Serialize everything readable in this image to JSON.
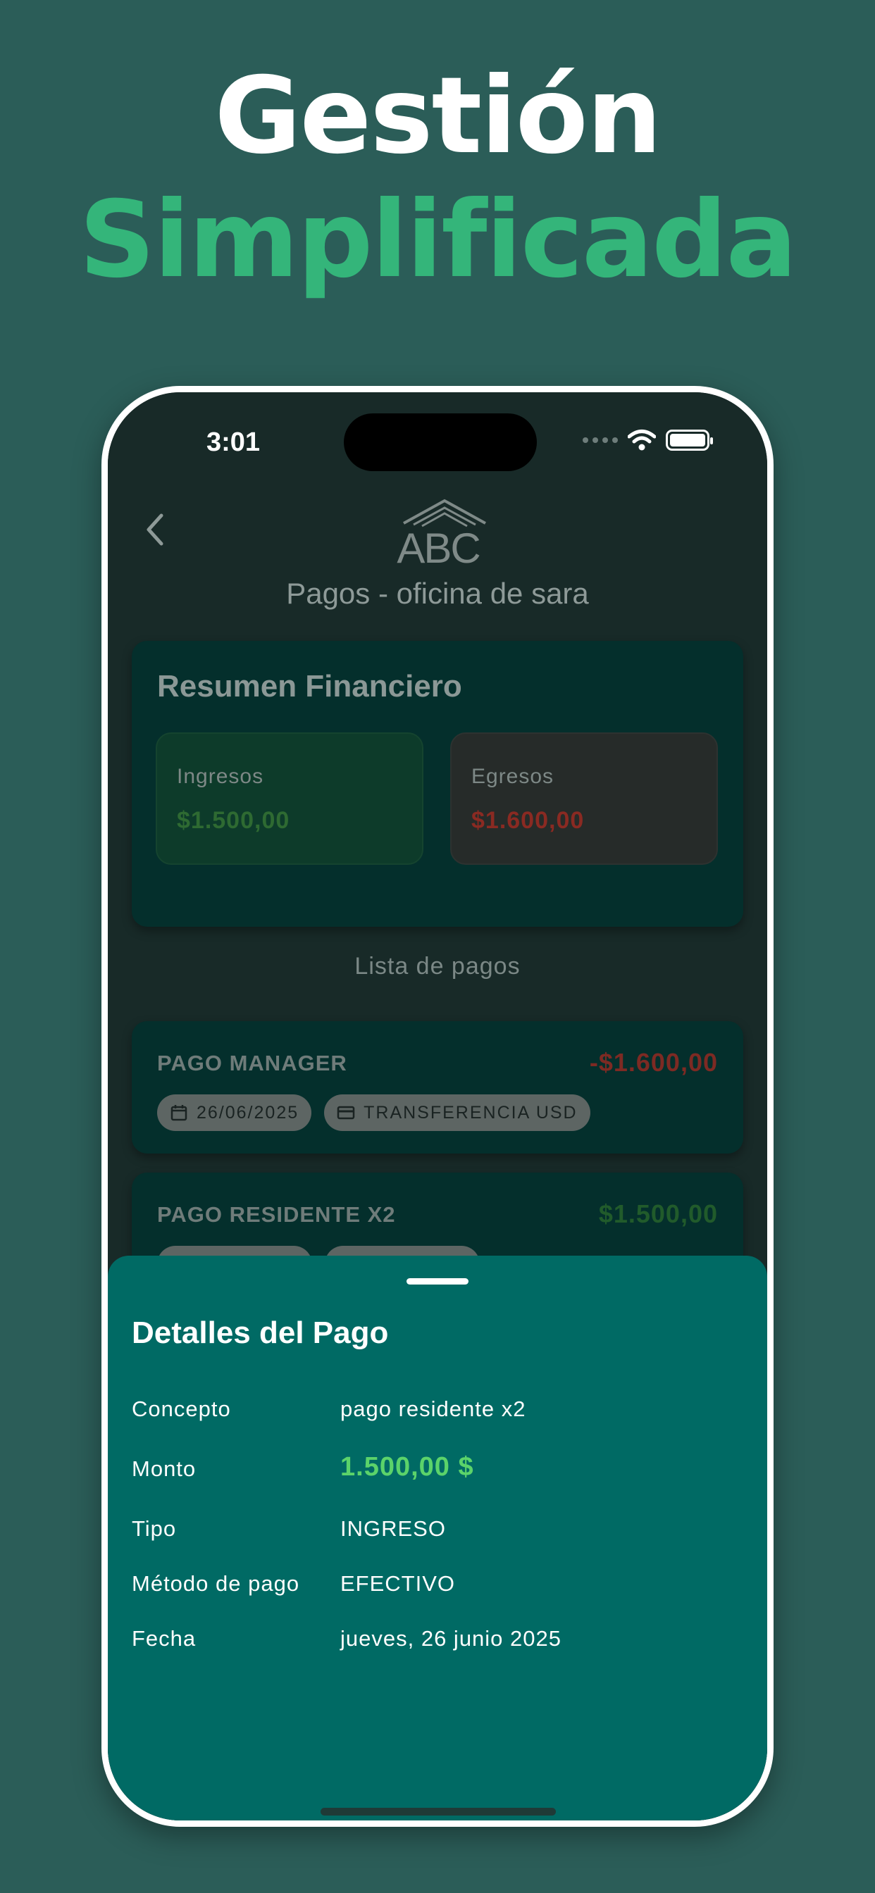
{
  "headline": {
    "line1": "Gestión",
    "line2": "Simplificada"
  },
  "status_bar": {
    "time": "3:01"
  },
  "header": {
    "logo_text": "ABC",
    "title": "Pagos - oficina de sara"
  },
  "summary": {
    "title": "Resumen Financiero",
    "income_label": "Ingresos",
    "income_value": "$1.500,00",
    "expense_label": "Egresos",
    "expense_value": "$1.600,00"
  },
  "list": {
    "title": "Lista de pagos",
    "payments": [
      {
        "name": "PAGO MANAGER",
        "amount": "-$1.600,00",
        "date": "26/06/2025",
        "method": "TRANSFERENCIA USD"
      },
      {
        "name": "PAGO RESIDENTE X2",
        "amount": "$1.500,00"
      }
    ]
  },
  "sheet": {
    "title": "Detalles del Pago",
    "rows": [
      {
        "label": "Concepto",
        "value": "pago residente x2"
      },
      {
        "label": "Monto",
        "value": "1.500,00 $"
      },
      {
        "label": "Tipo",
        "value": "INGRESO"
      },
      {
        "label": "Método de pago",
        "value": "EFECTIVO"
      },
      {
        "label": "Fecha",
        "value": "jueves, 26 junio 2025"
      }
    ]
  },
  "colors": {
    "background": "#2b5d58",
    "accent_green": "#34b57a",
    "sheet": "#006a64",
    "amount_positive": "#5bd36a",
    "amount_negative": "#8a2a22"
  },
  "icons": [
    "back-chevron-icon",
    "calendar-icon",
    "card-icon",
    "wifi-icon",
    "battery-icon"
  ]
}
